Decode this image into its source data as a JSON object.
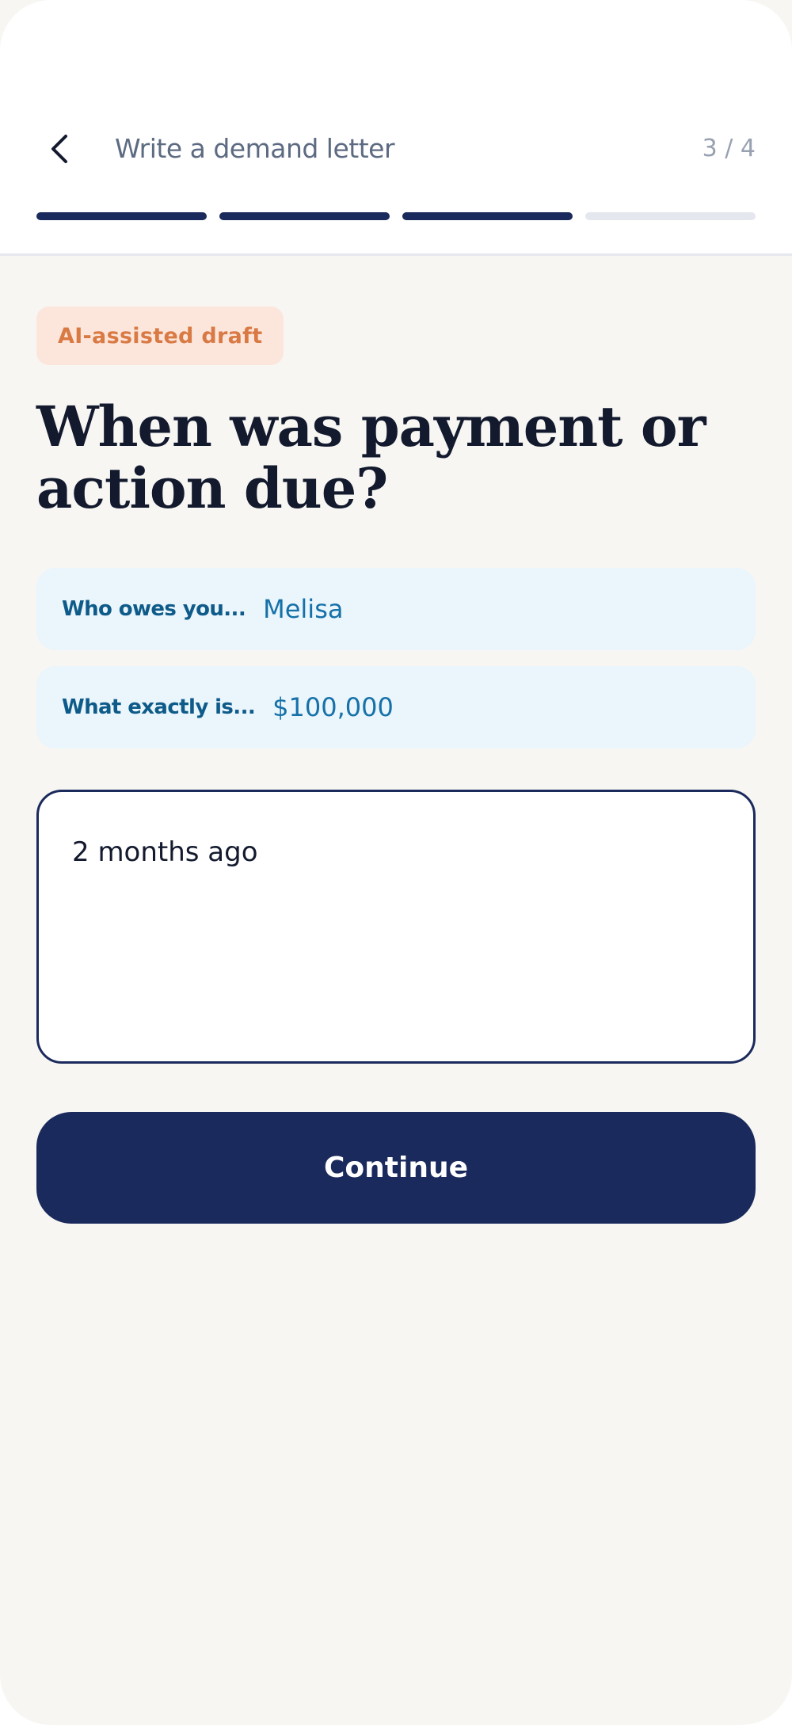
{
  "header": {
    "back_icon": "chevron-left-icon",
    "title": "Write a demand letter",
    "step": "3 / 4",
    "progress_segments": [
      "done",
      "done",
      "done",
      "todo"
    ]
  },
  "badge": "AI-assisted draft",
  "question": "When was payment or action due?",
  "previous_answers": [
    {
      "label": "Who owes you...",
      "value": "Melisa"
    },
    {
      "label": "What exactly is...",
      "value": "$100,000"
    }
  ],
  "answer_input": {
    "value": "2 months ago"
  },
  "continue_label": "Continue",
  "colors": {
    "primary": "#1b2a5c",
    "badge_bg": "#fce6dc",
    "badge_text": "#d97a44",
    "chip_bg": "#eaf5fc",
    "chip_text": "#0e5b8a",
    "background": "#f7f6f3"
  }
}
